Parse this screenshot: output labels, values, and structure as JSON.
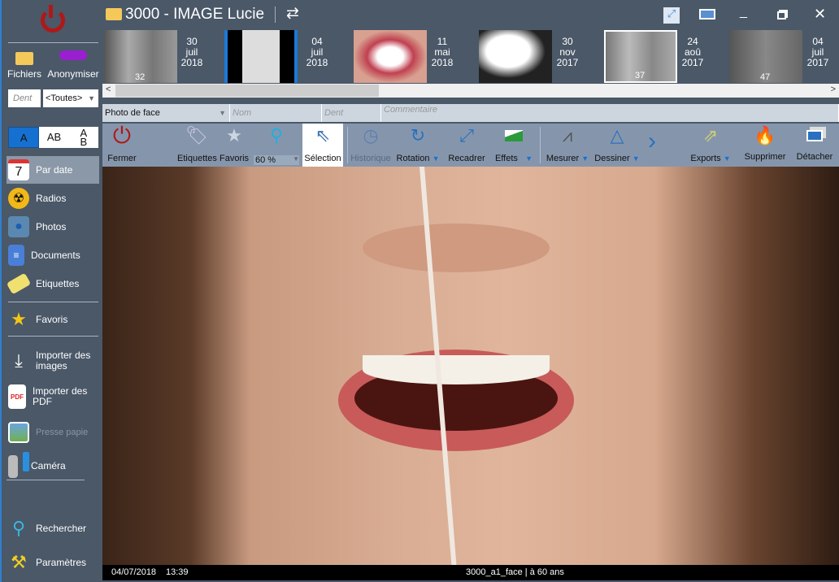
{
  "window": {
    "title": "3000 - IMAGE Lucie"
  },
  "sidebar": {
    "files_label": "Fichiers",
    "anonymize_label": "Anonymiser",
    "tooth_placeholder": "Dent",
    "tooth_filter": "<Toutes>",
    "text_modes": [
      "A",
      "AB",
      "A\nB"
    ],
    "items": [
      {
        "label": "Par date",
        "icon": "calendar-icon"
      },
      {
        "label": "Radios",
        "icon": "radiation-icon"
      },
      {
        "label": "Photos",
        "icon": "camera-icon"
      },
      {
        "label": "Documents",
        "icon": "document-icon"
      },
      {
        "label": "Etiquettes",
        "icon": "tag-icon"
      },
      {
        "label": "Favoris",
        "icon": "star-icon"
      },
      {
        "label": "Importer des images",
        "icon": "download-icon"
      },
      {
        "label": "Importer des PDF",
        "icon": "pdf-icon"
      },
      {
        "label": "Presse papie",
        "icon": "clipboard-icon"
      },
      {
        "label": "Caméra",
        "icon": "video-camera-icon"
      },
      {
        "label": "Rechercher",
        "icon": "search-icon"
      },
      {
        "label": "Paramètres",
        "icon": "tools-icon"
      }
    ]
  },
  "thumbnails": [
    {
      "day": "30",
      "month": "juil",
      "year": "2018",
      "badge": "32"
    },
    {
      "day": "04",
      "month": "juil",
      "year": "2018",
      "badge": ""
    },
    {
      "day": "11",
      "month": "mai",
      "year": "2018",
      "badge": ""
    },
    {
      "day": "30",
      "month": "nov",
      "year": "2017",
      "badge": ""
    },
    {
      "day": "24",
      "month": "aoû",
      "year": "2017",
      "badge": "37"
    },
    {
      "day": "04",
      "month": "juil",
      "year": "2017",
      "badge": "47"
    }
  ],
  "fields": {
    "type": "Photo de face",
    "name_placeholder": "Nom",
    "tooth_placeholder": "Dent",
    "comment_placeholder": "Commentaire"
  },
  "toolbar": {
    "close": "Fermer",
    "tags": "Etiquettes",
    "favorites": "Favoris",
    "zoom": "60 %",
    "selection": "Sélection",
    "history": "Historique",
    "rotation": "Rotation",
    "crop": "Recadrer",
    "effects": "Effets",
    "measure": "Mesurer",
    "draw": "Dessiner",
    "exports": "Exports",
    "delete": "Supprimer",
    "detach": "Détacher"
  },
  "status": {
    "date": "04/07/2018",
    "time": "13:39",
    "caption": "3000_a1_face | à 60 ans"
  }
}
